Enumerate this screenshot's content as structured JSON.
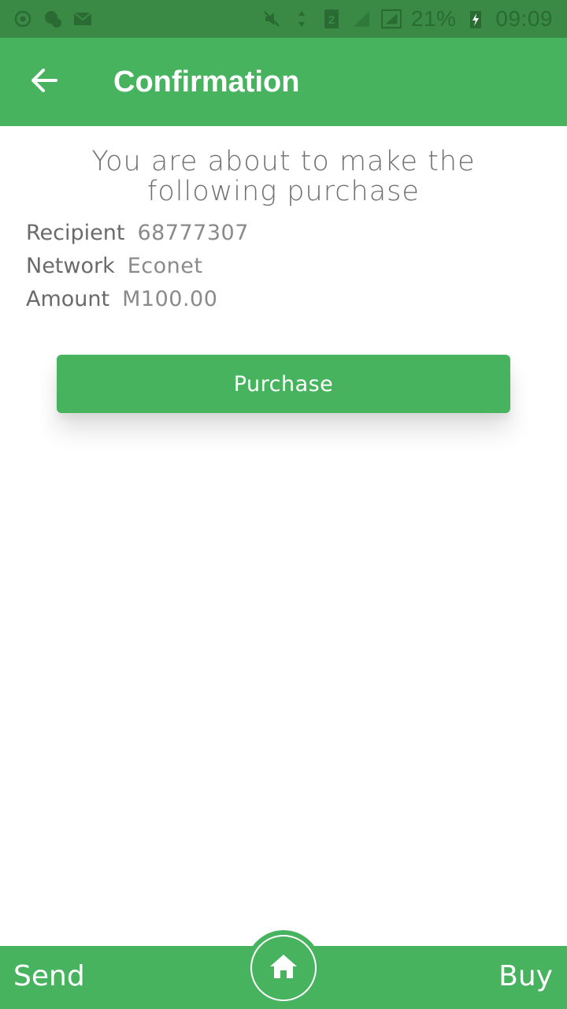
{
  "status_bar": {
    "battery_text": "21%",
    "time": "09:09",
    "icons": [
      "whatsapp-icon",
      "chat-icon",
      "mail-icon",
      "mute-icon",
      "wifi-icon",
      "sim-icon",
      "signal-icon",
      "battery-icon",
      "charging-icon"
    ]
  },
  "app_bar": {
    "title": "Confirmation",
    "back_icon": "arrow-left-icon"
  },
  "content": {
    "headline_line1": "You are about to make the",
    "headline_line2": "following purchase",
    "details": [
      {
        "label": "Recipient",
        "value": "68777307"
      },
      {
        "label": "Network",
        "value": "Econet"
      },
      {
        "label": "Amount",
        "value": "M100.00"
      }
    ],
    "purchase_button": "Purchase"
  },
  "bottom_bar": {
    "send_label": "Send",
    "buy_label": "Buy",
    "home_icon": "home-icon"
  },
  "colors": {
    "primary": "#47b35f",
    "status_bar": "#3a8a45",
    "text_gray": "#707070"
  }
}
